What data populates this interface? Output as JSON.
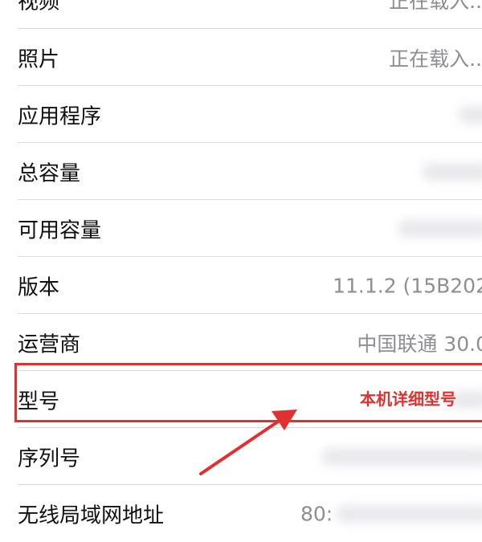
{
  "rows": [
    {
      "label": "视频",
      "value": "正在载入..."
    },
    {
      "label": "照片",
      "value": "正在载入..."
    },
    {
      "label": "应用程序",
      "value": ""
    },
    {
      "label": "总容量",
      "value": ""
    },
    {
      "label": "可用容量",
      "value": ""
    },
    {
      "label": "版本",
      "value": "11.1.2 (15B202"
    },
    {
      "label": "运营商",
      "value": "中国联通 30.0"
    },
    {
      "label": "型号",
      "value": ""
    },
    {
      "label": "序列号",
      "value": ""
    },
    {
      "label": "无线局域网地址",
      "value": "80:"
    }
  ],
  "annotation": {
    "text": "本机详细型号",
    "color": "#e0302f"
  }
}
